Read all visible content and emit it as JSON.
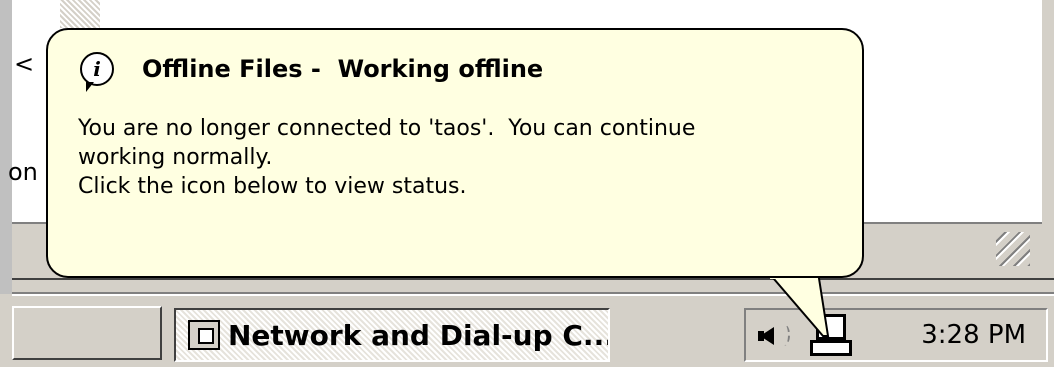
{
  "background_window": {
    "cut_text_1": "<",
    "cut_text_2": "on"
  },
  "balloon": {
    "icon": "info-icon",
    "title": "Offline Files -  Working offline",
    "body_lines": [
      "You are no longer connected to 'taos'.  You can continue",
      "working normally.",
      "Click the icon below to view status."
    ]
  },
  "taskbar": {
    "active_task_label": "Network and Dial-up C...",
    "active_task_icon": "network-folder-icon",
    "tray": {
      "icons": [
        "speaker-icon",
        "offline-files-computer-icon"
      ],
      "clock": "3:28 PM"
    }
  },
  "colors": {
    "balloon_bg": "#ffffe1",
    "face": "#d4d0c8",
    "window_bg": "#ffffff"
  }
}
